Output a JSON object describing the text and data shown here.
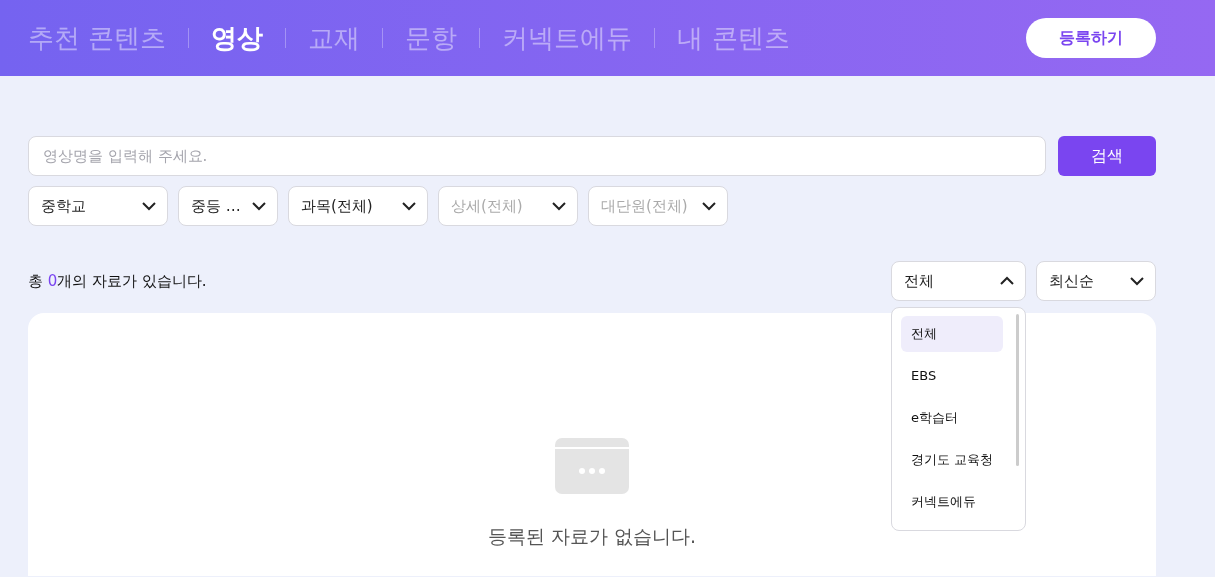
{
  "nav_tabs": [
    {
      "label": "추천 콘텐츠",
      "selected": false
    },
    {
      "label": "영상",
      "selected": true
    },
    {
      "label": "교재",
      "selected": false
    },
    {
      "label": "문항",
      "selected": false
    },
    {
      "label": "커넥트에듀",
      "selected": false
    },
    {
      "label": "내 콘텐츠",
      "selected": false
    }
  ],
  "register_button": "등록하기",
  "search": {
    "placeholder": "영상명을 입력해 주세요.",
    "button": "검색"
  },
  "filters": [
    {
      "label": "중학교",
      "disabled": false
    },
    {
      "label": "중등 …",
      "disabled": false
    },
    {
      "label": "과목(전체)",
      "disabled": false
    },
    {
      "label": "상세(전체)",
      "disabled": true
    },
    {
      "label": "대단원(전체)",
      "disabled": true
    }
  ],
  "result_count": {
    "before": "총 ",
    "count": "0",
    "after": "개의 자료가 있습니다."
  },
  "source_dropdown": {
    "label": "전체",
    "expanded": true,
    "options": [
      {
        "label": "전체",
        "selected": true
      },
      {
        "label": "EBS",
        "selected": false
      },
      {
        "label": "e학습터",
        "selected": false
      },
      {
        "label": "경기도 교육청",
        "selected": false
      },
      {
        "label": "커넥트에듀",
        "selected": false
      }
    ]
  },
  "sort_dropdown": {
    "label": "최신순",
    "expanded": false
  },
  "empty_message": "등록된 자료가 없습니다."
}
